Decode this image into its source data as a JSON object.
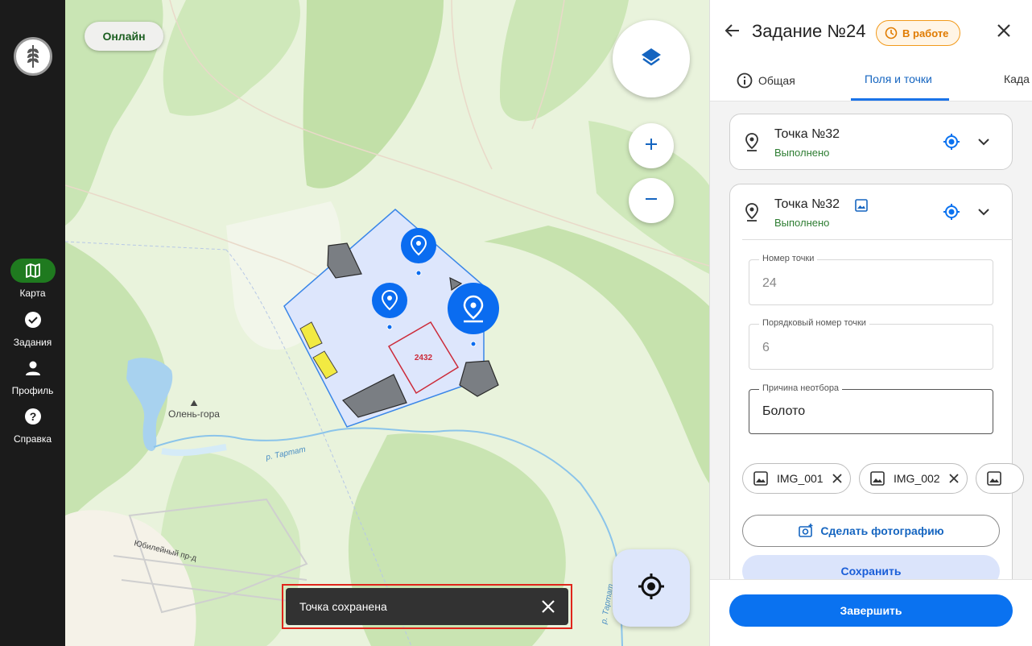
{
  "nav": {
    "items": [
      {
        "label": "Карта",
        "icon": "map-icon",
        "active": true
      },
      {
        "label": "Задания",
        "icon": "check-circle-icon"
      },
      {
        "label": "Профиль",
        "icon": "person-icon"
      },
      {
        "label": "Справка",
        "icon": "help-icon"
      }
    ]
  },
  "map": {
    "online_label": "Онлайн",
    "place_label": "Олень-гора",
    "river_label": "р. Тартат",
    "river_label_2": "р. Тартат",
    "road_label": "Юбилейный пр-д",
    "field_label": "2432"
  },
  "toast": {
    "text": "Точка сохранена"
  },
  "panel": {
    "title": "Задание №24",
    "status_badge": "В работе",
    "tabs": [
      {
        "label": "Общая",
        "active": false
      },
      {
        "label": "Поля и точки",
        "active": true
      },
      {
        "label": "Када",
        "active": false
      }
    ],
    "points": [
      {
        "name": "Точка №32",
        "status": "Выполнено"
      },
      {
        "name": "Точка №32",
        "status": "Выполнено"
      }
    ],
    "fields": {
      "point_number": {
        "label": "Номер точки",
        "value": "24"
      },
      "order_number": {
        "label": "Порядковый номер точки",
        "value": "6"
      },
      "reason": {
        "label": "Причина неотбора",
        "value": "Болото"
      }
    },
    "photos": [
      "IMG_001",
      "IMG_002"
    ],
    "take_photo_label": "Сделать фотографию",
    "save_label": "Сохранить",
    "finish_label": "Завершить"
  },
  "colors": {
    "accent": "#0a72f0",
    "status_ok": "#2e7d32",
    "badge": "#f29a1b",
    "nav_bg": "#1b1b1b"
  }
}
